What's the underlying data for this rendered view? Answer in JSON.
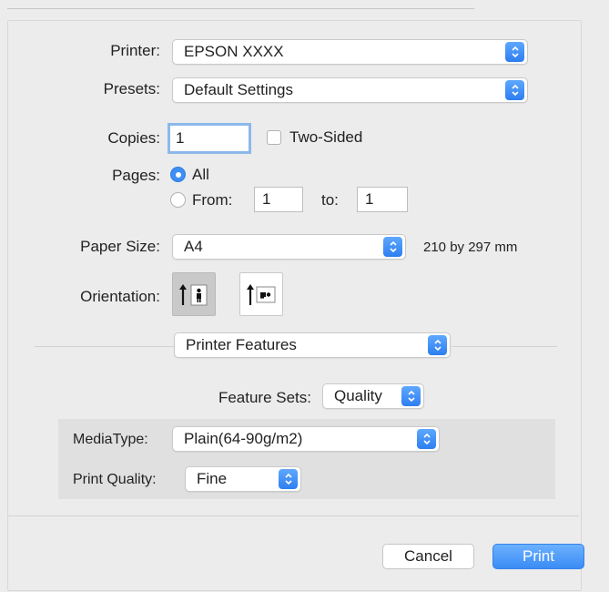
{
  "printer": {
    "label": "Printer:",
    "value": "EPSON XXXX"
  },
  "presets": {
    "label": "Presets:",
    "value": "Default Settings"
  },
  "copies": {
    "label": "Copies:",
    "value": "1",
    "two_sided_label": "Two-Sided",
    "two_sided_checked": false
  },
  "pages": {
    "label": "Pages:",
    "all_label": "All",
    "from_label": "From:",
    "from_value": "1",
    "to_label": "to:",
    "to_value": "1",
    "selected": "All"
  },
  "paper_size": {
    "label": "Paper Size:",
    "value": "A4",
    "dimensions": "210 by 297 mm"
  },
  "orientation": {
    "label": "Orientation:",
    "options": [
      "portrait",
      "landscape"
    ],
    "selected": "portrait"
  },
  "section_menu": {
    "value": "Printer Features"
  },
  "feature_sets": {
    "label": "Feature Sets:",
    "value": "Quality"
  },
  "media_type": {
    "label": "MediaType:",
    "value": "Plain(64-90g/m2)"
  },
  "print_quality": {
    "label": "Print Quality:",
    "value": "Fine"
  },
  "buttons": {
    "cancel": "Cancel",
    "print": "Print"
  },
  "colors": {
    "accent": "#3d8ef5",
    "background": "#ececec",
    "panel": "#e0e0e0"
  }
}
